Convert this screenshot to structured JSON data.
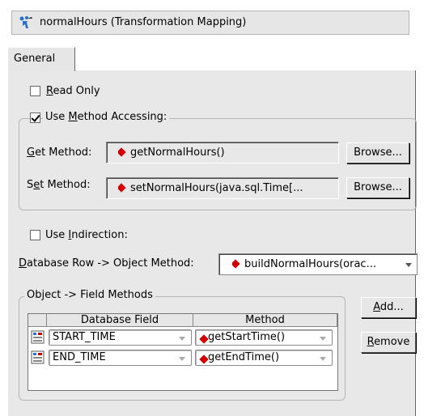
{
  "title": "normalHours (Transformation Mapping)",
  "tab": "General",
  "read_only": {
    "label_prefix": "",
    "label_hot": "R",
    "label_rest": "ead Only",
    "checked": false
  },
  "use_method_accessing": {
    "label_prefix": "Use ",
    "label_hot": "M",
    "label_rest": "ethod Accessing:",
    "checked": true
  },
  "get_method": {
    "label_hot": "G",
    "label_rest": "et Method:",
    "value": "getNormalHours()",
    "button": "Browse..."
  },
  "set_method": {
    "label_pre": "S",
    "label_hot": "e",
    "label_rest": "t Method:",
    "value": "setNormalHours(java.sql.Time[...",
    "button": "Browse..."
  },
  "use_indirection": {
    "label_prefix": "Use ",
    "label_hot": "I",
    "label_rest": "ndirection:",
    "checked": false
  },
  "db_row_method": {
    "label_hot": "D",
    "label_rest": "atabase Row -> Object Method:",
    "value": "buildNormalHours(orac..."
  },
  "field_methods": {
    "legend": "Object -> Field Methods",
    "columns": [
      "Database Field",
      "Method"
    ],
    "rows": [
      {
        "field": "START_TIME",
        "method": "getStartTime()"
      },
      {
        "field": "END_TIME",
        "method": "getEndTime()"
      }
    ],
    "add_hot": "A",
    "add_rest": "dd...",
    "remove_hot": "R",
    "remove_rest": "emove"
  },
  "icons": {
    "title": "transformation-mapping-icon",
    "row": "database-field-icon",
    "method": "method-diamond-icon",
    "dropdown": "chevron-down-icon"
  }
}
